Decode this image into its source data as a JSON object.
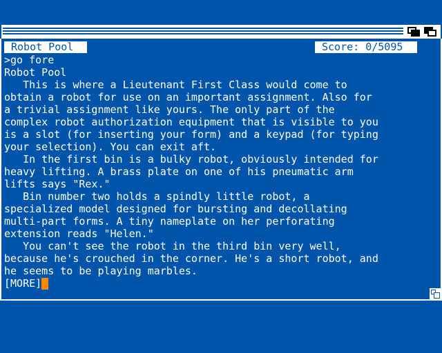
{
  "window": {
    "location": "Robot Pool",
    "score_label": "Score: 0/5095"
  },
  "transcript": {
    "lines": [
      ">go fore",
      "Robot Pool",
      "   This is where a Lieutenant First Class would come to",
      "obtain a robot for use on an important assignment. Also for",
      "a trivial assignment like yours. The only part of the",
      "complex robot authorization equipment that is visible to you",
      "is a slot (for inserting your form) and a keypad (for typing",
      "your selection). You can exit aft.",
      "   In the first bin is a bulky robot, obviously intended for",
      "heavy lifting. A brass plate on one of his pneumatic arm",
      "lifts says \"Rex.\"",
      "   Bin number two holds a spindly little robot, a",
      "specialized model designed for bursting and decollating",
      "multi-part forms. A tiny nameplate on her perforating",
      "extension reads \"Helen.\"",
      "   You can't see the robot in the third bin very well,",
      "because he's crouched in the corner. He's a short robot, and",
      "he seems to be playing marbles."
    ],
    "more_prompt": "[MORE]"
  },
  "colors": {
    "background": "#0055aa",
    "foreground": "#ffffff",
    "cursor": "#ff8800",
    "gadget_dark": "#000000"
  },
  "icons": {
    "depth_back": "depth-back-icon",
    "depth_front": "depth-front-icon",
    "resize": "resize-icon"
  }
}
